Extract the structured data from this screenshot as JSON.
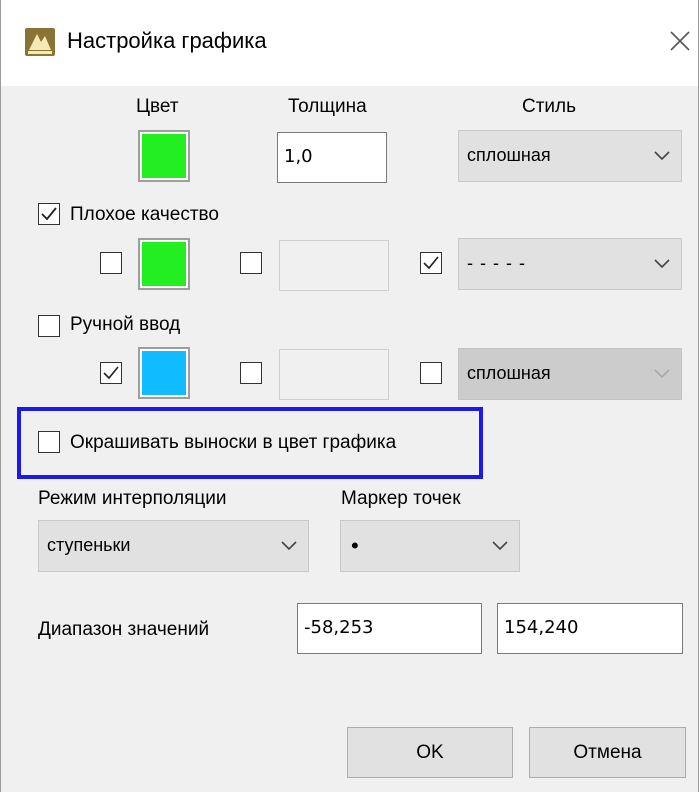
{
  "window": {
    "title": "Настройка графика",
    "colors": {
      "accent": "#1a1aee",
      "green": "#22ee22",
      "blue": "#11bbff"
    }
  },
  "header": {
    "color_label": "Цвет",
    "thickness_label": "Толщина",
    "style_label": "Стиль"
  },
  "main_line": {
    "color": "#22ee22",
    "thickness": "1,0",
    "style": "сплошная"
  },
  "bad_quality": {
    "label": "Плохое качество",
    "checked": true,
    "color_checked": false,
    "color": "#22ee22",
    "thickness_checked": false,
    "thickness": "",
    "style_checked": true,
    "style": "- - - - -"
  },
  "manual_input": {
    "label": "Ручной ввод",
    "checked": false,
    "color_checked": true,
    "color": "#11bbff",
    "thickness_checked": false,
    "thickness": "",
    "style_checked": false,
    "style": "сплошная"
  },
  "callouts": {
    "label": "Окрашивать выноски в цвет графика",
    "checked": false
  },
  "interpolation": {
    "label": "Режим интерполяции",
    "value": "ступеньки"
  },
  "marker": {
    "label": "Маркер точек",
    "value": "•"
  },
  "range": {
    "label": "Диапазон значений",
    "min": "-58,253",
    "max": "154,240"
  },
  "buttons": {
    "ok": "OK",
    "cancel": "Отмена"
  }
}
